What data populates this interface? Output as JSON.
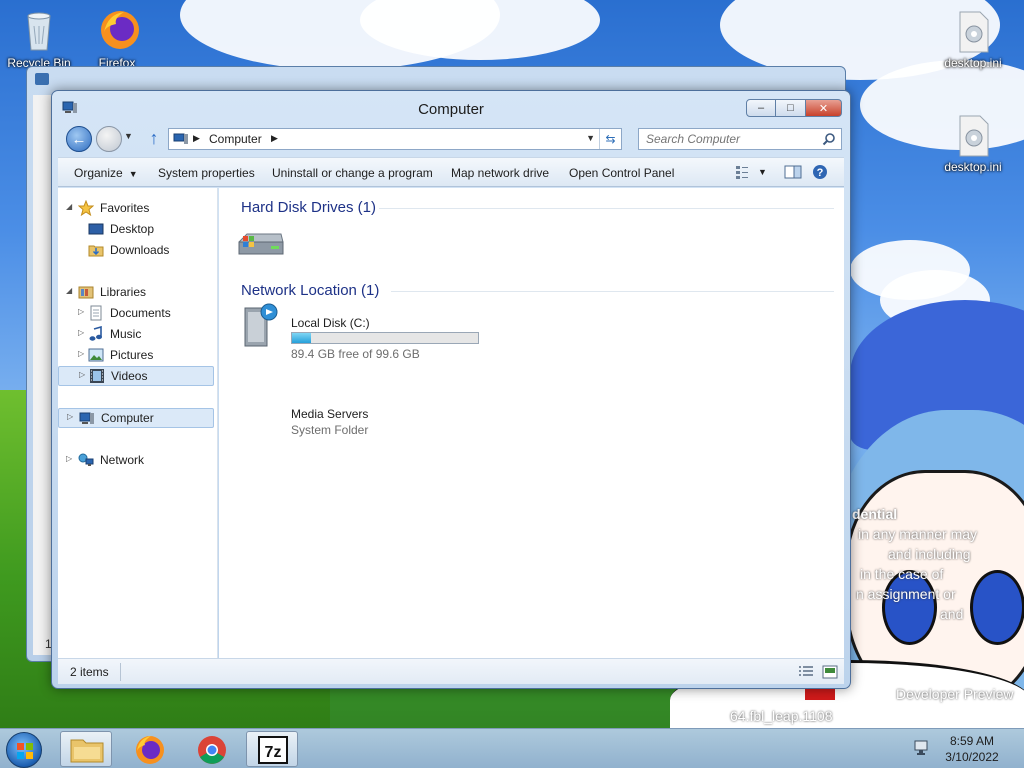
{
  "desktop": {
    "icons": [
      {
        "label": "Recycle Bin",
        "icon": "recycle-bin-icon"
      },
      {
        "label": "Firefox",
        "icon": "firefox-icon"
      },
      {
        "label": "desktop.ini",
        "icon": "ini-file-icon"
      },
      {
        "label": "desktop.ini",
        "icon": "ini-file-icon"
      }
    ],
    "watermark": {
      "line1": "dential",
      "line2": "in any manner may",
      "line3": "and including",
      "line4": "in the case of",
      "line5": "n assignment or",
      "line6": "and",
      "line7": "Developer Preview",
      "line8": "64.fbl_leap.1108"
    },
    "back_window_number": "1"
  },
  "window": {
    "title": "Computer",
    "controls": {
      "minimize": "–",
      "maximize": "□",
      "close": "✕"
    }
  },
  "address": {
    "breadcrumb": "Computer",
    "search_placeholder": "Search Computer"
  },
  "toolbar": {
    "organize": "Organize",
    "system_properties": "System properties",
    "uninstall": "Uninstall or change a program",
    "map_drive": "Map network drive",
    "control_panel": "Open Control Panel"
  },
  "nav_pane": {
    "favorites": "Favorites",
    "desktop": "Desktop",
    "downloads": "Downloads",
    "libraries": "Libraries",
    "documents": "Documents",
    "music": "Music",
    "pictures": "Pictures",
    "videos": "Videos",
    "computer": "Computer",
    "network": "Network"
  },
  "content": {
    "hard_disk_header": "Hard Disk Drives (1)",
    "drive_name": "Local Disk (C:)",
    "drive_free": "89.4 GB free of 99.6 GB",
    "drive_used_fraction": 0.1,
    "network_header": "Network Location (1)",
    "media_name": "Media Servers",
    "media_type": "System Folder"
  },
  "status": {
    "items": "2 items"
  },
  "taskbar": {
    "time": "8:59 AM",
    "date": "3/10/2022",
    "apps": [
      "explorer-icon",
      "firefox-icon",
      "chrome-icon",
      "7zip-icon"
    ]
  },
  "colors": {
    "group_header": "#1e3287",
    "selection": "#dbe9f8",
    "drive_fill": "#26a0da"
  }
}
